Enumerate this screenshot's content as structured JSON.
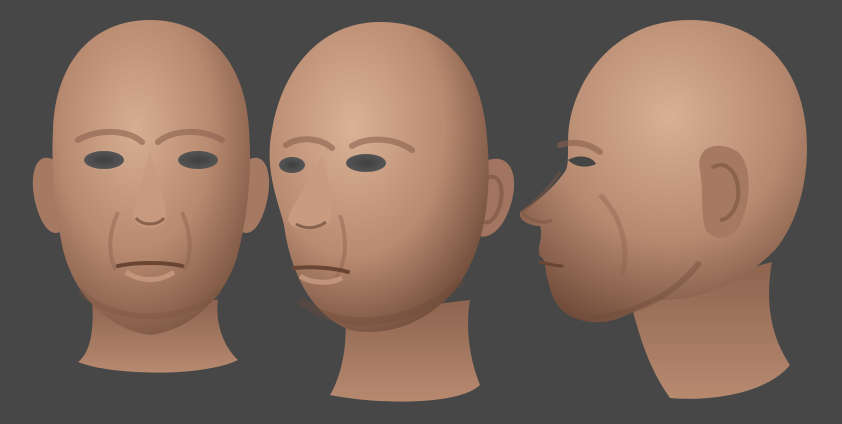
{
  "scene": {
    "background_color": "#474747",
    "material_colors": {
      "highlight": "#D7AE92",
      "base": "#B88A70",
      "shadow": "#7A5440",
      "deep_shadow": "#4A3226"
    },
    "views": [
      {
        "id": "front",
        "description_visible": false
      },
      {
        "id": "three-quarter",
        "description_visible": false
      },
      {
        "id": "profile",
        "description_visible": false
      }
    ]
  }
}
